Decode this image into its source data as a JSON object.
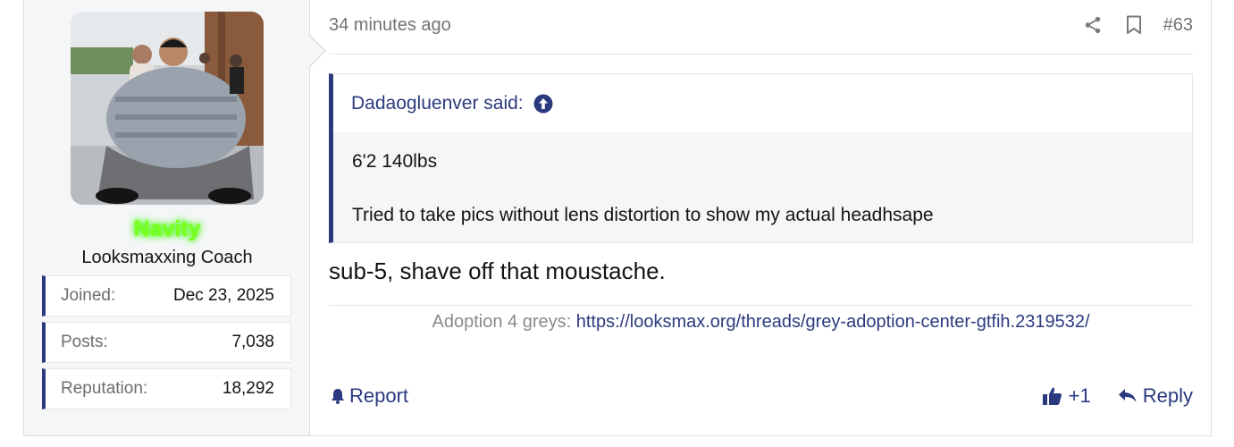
{
  "post": {
    "time": "34 minutes ago",
    "number": "#63",
    "icons": {
      "share": "share-icon",
      "bookmark": "bookmark-icon"
    }
  },
  "user": {
    "avatar": "avatar",
    "username": "Navity",
    "title": "Looksmaxxing Coach",
    "stats": [
      {
        "label": "Joined:",
        "value": "Dec 23, 2025"
      },
      {
        "label": "Posts:",
        "value": "7,038"
      },
      {
        "label": "Reputation:",
        "value": "18,292"
      }
    ]
  },
  "quote": {
    "author": "Dadaogluenver said:",
    "lines": [
      "6'2 140lbs",
      "Tried to take pics without lens distortion to show my actual headhsape"
    ]
  },
  "body": "sub-5, shave off that moustache.",
  "signature": {
    "prefix": "Adoption 4 greys: ",
    "link": "https://looksmax.org/threads/grey-adoption-center-gtfih.2319532/"
  },
  "actions": {
    "report": "Report",
    "like": "+1",
    "reply": "Reply"
  },
  "colors": {
    "accent": "#2b3a7f",
    "username": "#7cff1e",
    "muted": "#737373"
  }
}
